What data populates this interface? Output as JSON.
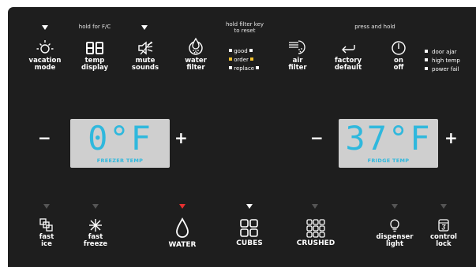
{
  "top_hints": {
    "hold_fc": "hold for F/C",
    "hold_filter_1": "hold filter key",
    "hold_filter_2": "to reset",
    "press_hold": "press and hold"
  },
  "top_buttons": {
    "vacation": {
      "line1": "vacation",
      "line2": "mode",
      "icon": "sun-icon"
    },
    "temp_display": {
      "line1": "temp",
      "line2": "display",
      "icon": "seven-segment-88-icon"
    },
    "mute": {
      "line1": "mute",
      "line2": "sounds",
      "icon": "speaker-mute-icon"
    },
    "water_filter": {
      "line1": "water",
      "line2": "filter",
      "icon": "water-filter-icon"
    },
    "air_filter": {
      "line1": "air",
      "line2": "filter",
      "icon": "air-filter-icon"
    },
    "factory": {
      "line1": "factory",
      "line2": "default",
      "icon": "return-arrow-icon"
    },
    "onoff": {
      "line1": "on",
      "line2": "off",
      "icon": "power-icon"
    }
  },
  "filter_status": {
    "good": "good",
    "order": "order",
    "replace": "replace",
    "colors": {
      "good": "#ffffff",
      "order": "#f2c12e",
      "replace": "#ffffff"
    }
  },
  "alerts": {
    "door_ajar": "door ajar",
    "high_temp": "high temp",
    "power_fail": "power fail"
  },
  "freezer": {
    "minus": "−",
    "plus": "+",
    "temperature": "0°F",
    "caption": "FREEZER TEMP"
  },
  "fridge": {
    "minus": "−",
    "plus": "+",
    "temperature": "37°F",
    "caption": "FRIDGE TEMP"
  },
  "bottom_buttons": {
    "fast_ice": {
      "line1": "fast",
      "line2": "ice",
      "icon": "fast-ice-icon"
    },
    "fast_freeze": {
      "line1": "fast",
      "line2": "freeze",
      "icon": "snowflake-icon"
    },
    "water": {
      "label": "WATER",
      "icon": "water-drop-icon",
      "indicator": "selected-red"
    },
    "cubes": {
      "label": "CUBES",
      "icon": "ice-cubes-icon",
      "indicator": "white"
    },
    "crushed": {
      "label": "CRUSHED",
      "icon": "crushed-ice-icon"
    },
    "dispenser_light": {
      "line1": "dispenser",
      "line2": "light",
      "icon": "light-bulb-icon"
    },
    "control_lock": {
      "line1": "control",
      "line2": "lock",
      "icon": "lock-3-icon"
    }
  },
  "colors": {
    "panel": "#1e1e1e",
    "lcd": "#cfcfcf",
    "digits": "#2fb8dd",
    "accent_red": "#e53030",
    "amber": "#f2c12e"
  }
}
